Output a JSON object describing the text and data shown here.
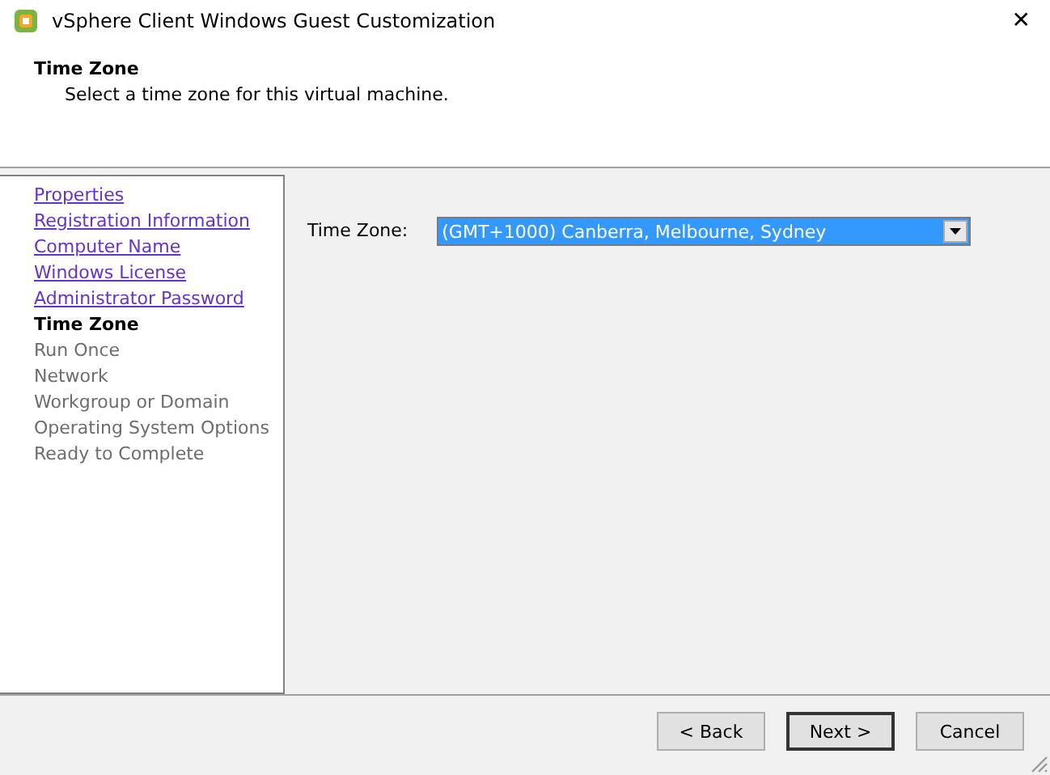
{
  "window": {
    "title": "vSphere Client Windows Guest Customization",
    "close": "✕"
  },
  "header": {
    "title": "Time Zone",
    "subtitle": "Select a time zone for this virtual machine."
  },
  "steps": [
    {
      "label": "Properties",
      "kind": "link"
    },
    {
      "label": "Registration Information",
      "kind": "link"
    },
    {
      "label": "Computer Name",
      "kind": "link"
    },
    {
      "label": "Windows License",
      "kind": "link"
    },
    {
      "label": "Administrator Password",
      "kind": "link"
    },
    {
      "label": "Time Zone",
      "kind": "current"
    },
    {
      "label": "Run Once",
      "kind": "pending"
    },
    {
      "label": "Network",
      "kind": "pending"
    },
    {
      "label": "Workgroup or Domain",
      "kind": "pending"
    },
    {
      "label": "Operating System Options",
      "kind": "pending"
    },
    {
      "label": "Ready to Complete",
      "kind": "pending"
    }
  ],
  "form": {
    "label": "Time Zone:",
    "value": "(GMT+1000) Canberra, Melbourne, Sydney"
  },
  "buttons": [
    {
      "label": "< Back",
      "default": false
    },
    {
      "label": "Next >",
      "default": true
    },
    {
      "label": "Cancel",
      "default": false
    }
  ]
}
